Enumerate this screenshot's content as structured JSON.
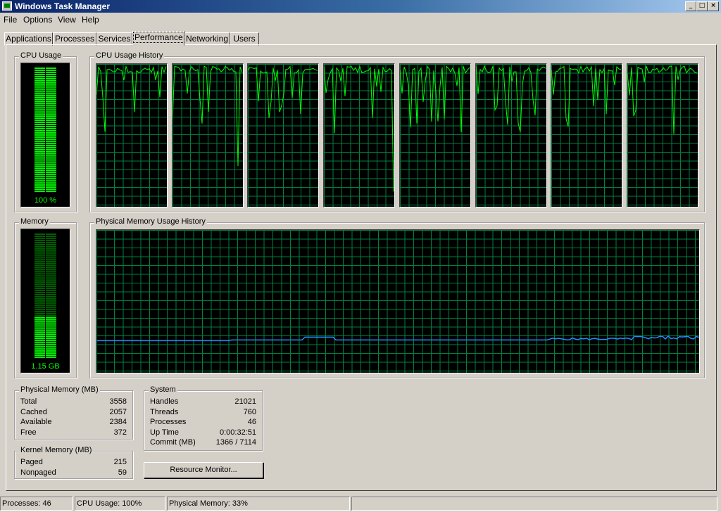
{
  "window": {
    "title": "Windows Task Manager",
    "app_icon": "task-manager-icon",
    "buttons": {
      "minimize": "_",
      "maximize": "□",
      "close": "×"
    }
  },
  "menu": [
    "File",
    "Options",
    "View",
    "Help"
  ],
  "tabs": [
    "Applications",
    "Processes",
    "Services",
    "Performance",
    "Networking",
    "Users"
  ],
  "active_tab": "Performance",
  "cpu": {
    "group_title": "CPU Usage",
    "value_label": "100 %",
    "usage_fraction": 1.0,
    "history_title": "CPU Usage History",
    "core_count": 8
  },
  "memory": {
    "group_title": "Memory",
    "value_label": "1.15 GB",
    "usage_fraction": 0.33,
    "history_title": "Physical Memory Usage History"
  },
  "physical_memory": {
    "title": "Physical Memory (MB)",
    "rows": [
      {
        "label": "Total",
        "value": "3558"
      },
      {
        "label": "Cached",
        "value": "2057"
      },
      {
        "label": "Available",
        "value": "2384"
      },
      {
        "label": "Free",
        "value": "372"
      }
    ]
  },
  "kernel_memory": {
    "title": "Kernel Memory (MB)",
    "rows": [
      {
        "label": "Paged",
        "value": "215"
      },
      {
        "label": "Nonpaged",
        "value": "59"
      }
    ]
  },
  "system": {
    "title": "System",
    "rows": [
      {
        "label": "Handles",
        "value": "21021"
      },
      {
        "label": "Threads",
        "value": "760"
      },
      {
        "label": "Processes",
        "value": "46"
      },
      {
        "label": "Up Time",
        "value": "0:00:32:51"
      },
      {
        "label": "Commit (MB)",
        "value": "1366 / 7114"
      }
    ]
  },
  "resource_monitor_button": "Resource Monitor...",
  "status": {
    "processes": "Processes: 46",
    "cpu": "CPU Usage: 100%",
    "memory": "Physical Memory: 33%"
  },
  "colors": {
    "meter_green": "#00ff00",
    "grid_green": "#008040",
    "memory_line": "#1e90ff",
    "background": "#d4d0c8"
  }
}
